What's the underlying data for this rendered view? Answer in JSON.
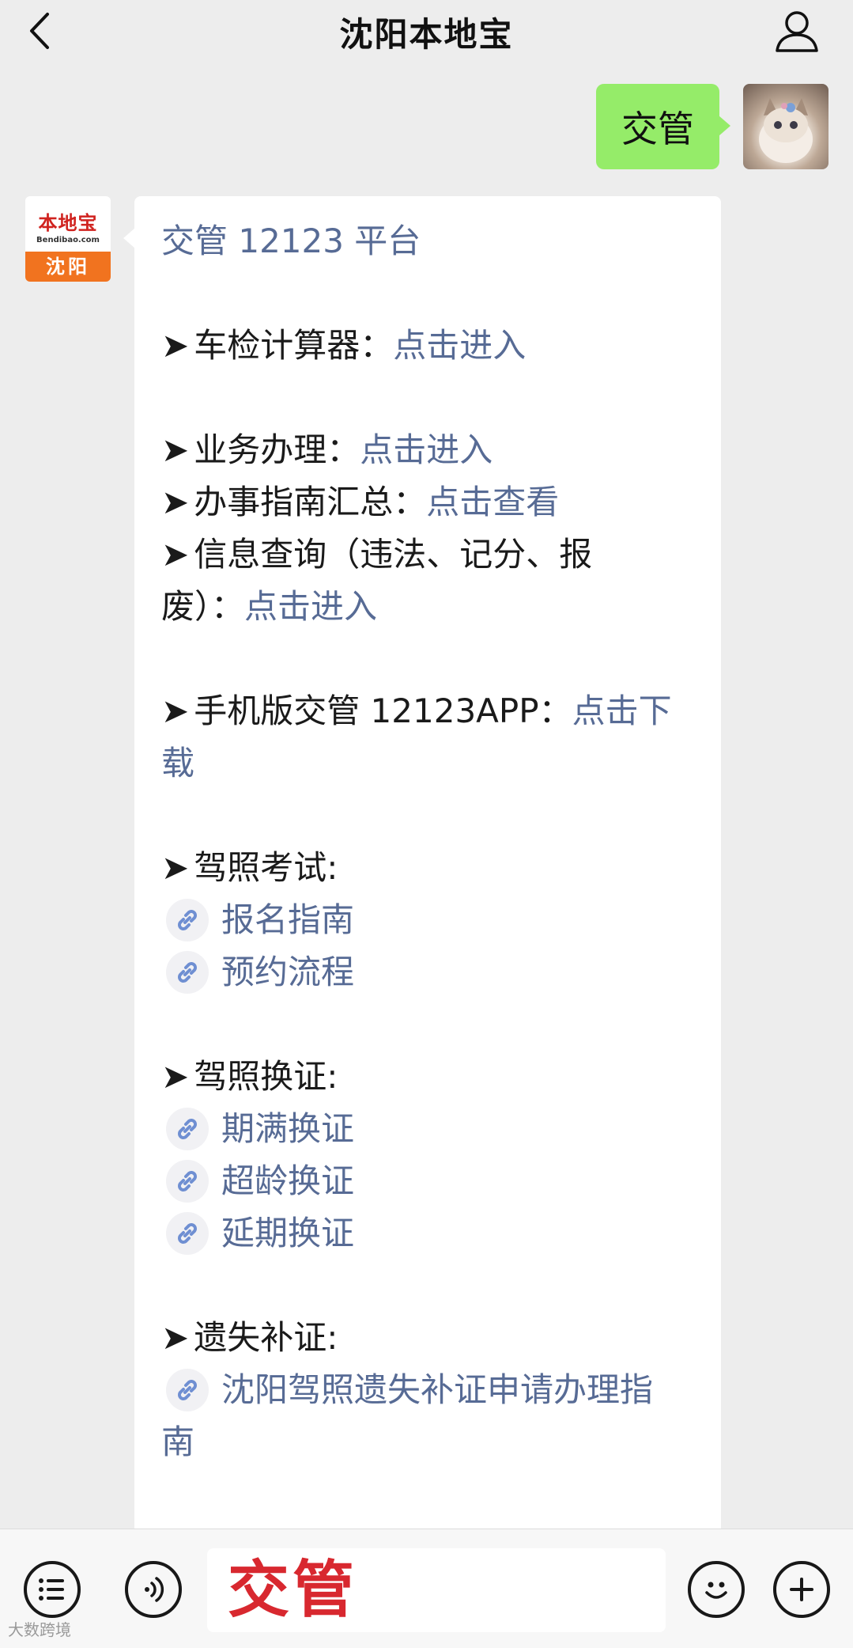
{
  "header": {
    "title": "沈阳本地宝"
  },
  "out_message": {
    "text": "交管"
  },
  "bot": {
    "logo_text": "本地宝",
    "logo_sub": "Bendibao.com",
    "city": "沈阳"
  },
  "message": {
    "title": "交管 12123 平台",
    "arrow": "➤",
    "vehicle_calc": {
      "label": "车检计算器：",
      "link": "点击进入"
    },
    "business": {
      "label": "业务办理：",
      "link": "点击进入"
    },
    "guide": {
      "label": "办事指南汇总：",
      "link": "点击查看"
    },
    "info_query": {
      "label_1": "信息查询（违法、记分、报",
      "label_2": "废）：",
      "link": "点击进入"
    },
    "app": {
      "label": "手机版交管 12123APP：",
      "link_1": "点击下",
      "link_2": "载"
    },
    "exam": {
      "label": "驾照考试:",
      "links": [
        "报名指南",
        "预约流程"
      ]
    },
    "renew": {
      "label": "驾照换证:",
      "links": [
        "期满换证",
        "超龄换证",
        "延期换证"
      ]
    },
    "lost": {
      "label": "遗失补证:",
      "link_1": "沈阳驾照遗失补证申请办理指",
      "link_2": "南"
    }
  },
  "input": {
    "value": "交管"
  },
  "watermark": "大数跨境"
}
